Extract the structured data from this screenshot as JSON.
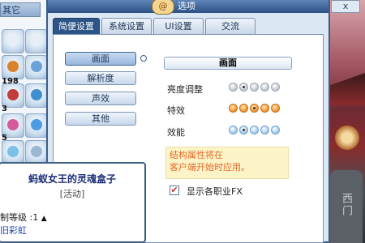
{
  "window": {
    "emblem": "@",
    "title": "选项"
  },
  "corner_button": "x",
  "left_panel": {
    "tab_label": "其它",
    "slot_counts": [
      "198",
      "3",
      "5"
    ]
  },
  "tabs": [
    {
      "label": "简便设置",
      "active": true
    },
    {
      "label": "系统设置",
      "active": false
    },
    {
      "label": "UI设置",
      "active": false
    },
    {
      "label": "交流",
      "active": false
    }
  ],
  "side_menu": [
    {
      "label": "画面",
      "active": true
    },
    {
      "label": "解析度",
      "active": false
    },
    {
      "label": "声效",
      "active": false
    },
    {
      "label": "其他",
      "active": false
    }
  ],
  "section_title": "画面",
  "options": [
    {
      "label": "亮度调整",
      "style": "grey",
      "levels": 5,
      "selected": 1
    },
    {
      "label": "特效",
      "style": "orange",
      "levels": 5,
      "selected": 2
    },
    {
      "label": "效能",
      "style": "blue",
      "levels": 5,
      "selected": 1
    }
  ],
  "note": {
    "line1": "结构属性将在",
    "line2": "客户端开始时应用。"
  },
  "checkbox": {
    "checked": true,
    "label": "显示各职业FX"
  },
  "tooltip": {
    "title": "蚂蚁女王的灵魂盒子",
    "subtitle": "[活动]",
    "level_label": "制等级",
    "level_value": ":1",
    "color_label": "旧彩虹"
  },
  "background": {
    "stone_text": "西门"
  },
  "colors": {
    "accent": "#2d5487",
    "note_text": "#e06a2c",
    "tooltip_title": "#1c2f78"
  }
}
